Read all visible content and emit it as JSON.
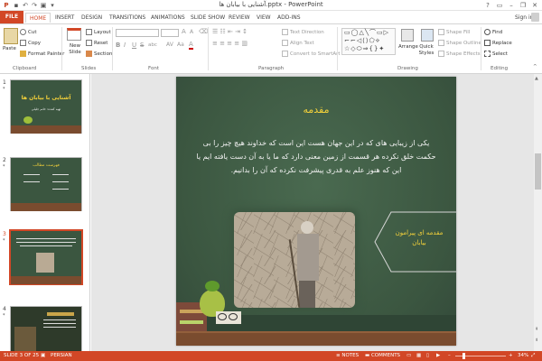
{
  "window": {
    "title": "آشنایی با بیابان ها.pptx - PowerPoint",
    "help": "?",
    "min": "–",
    "restore": "❐",
    "close": "✕",
    "signin": "Sign in"
  },
  "tabs": [
    {
      "label": "FILE"
    },
    {
      "label": "HOME"
    },
    {
      "label": "INSERT"
    },
    {
      "label": "DESIGN"
    },
    {
      "label": "TRANSITIONS"
    },
    {
      "label": "ANIMATIONS"
    },
    {
      "label": "SLIDE SHOW"
    },
    {
      "label": "REVIEW"
    },
    {
      "label": "VIEW"
    },
    {
      "label": "ADD-INS"
    }
  ],
  "ribbon": {
    "clipboard": {
      "paste": "Paste",
      "cut": "Cut",
      "copy": "Copy",
      "format_painter": "Format Painter",
      "label": "Clipboard"
    },
    "slides": {
      "new_slide": "New Slide",
      "layout": "Layout",
      "reset": "Reset",
      "section": "Section",
      "label": "Slides"
    },
    "font": {
      "label": "Font",
      "bold": "B",
      "italic": "I",
      "underline": "U",
      "strike": "S",
      "shadow": "abc",
      "size_up": "A",
      "size_down": "A",
      "font_color": "A"
    },
    "paragraph": {
      "text_direction": "Text Direction",
      "align_text": "Align Text",
      "convert_smartart": "Convert to SmartArt",
      "label": "Paragraph"
    },
    "drawing": {
      "arrange": "Arrange",
      "quick_styles": "Quick Styles",
      "shape_fill": "Shape Fill",
      "shape_outline": "Shape Outline",
      "shape_effects": "Shape Effects",
      "label": "Drawing"
    },
    "editing": {
      "find": "Find",
      "replace": "Replace",
      "select": "Select",
      "label": "Editing"
    }
  },
  "thumbnails": [
    {
      "num": "1",
      "star": "*",
      "title": "آشنایی با بیابان ها",
      "subtitle": "تهیه کننده: خانم جلیلی"
    },
    {
      "num": "2",
      "star": "*",
      "title": "فهرست مطالب"
    },
    {
      "num": "3",
      "star": "*"
    },
    {
      "num": "4",
      "star": "*"
    }
  ],
  "slide": {
    "title": "مقدمه",
    "body": "یکی از زیبایی های که در این جهان هست این است که خداوند هیچ چیز را بی حکمت خلق نکرده هر قسمت از زمین معنی دارد که ما یا به آن دست یافته ایم یا این که هنوز علم به قدری پیشرفت نکرده که آن را بدانیم.",
    "callout": "مقدمه ای پیرامون بیابان"
  },
  "status": {
    "slide": "SLIDE 3 OF 25",
    "language": "PERSIAN",
    "notes": "NOTES",
    "comments": "COMMENTS",
    "zoom": "34%",
    "zoom_level": 0.34
  },
  "colors": {
    "accent": "#d24726",
    "chalkboard": "#3e5a43",
    "title_yellow": "#f5d23a"
  }
}
